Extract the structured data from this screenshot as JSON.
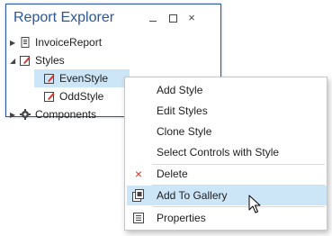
{
  "panel": {
    "title": "Report Explorer",
    "close_glyph": "×"
  },
  "tree": [
    {
      "label": "InvoiceReport",
      "icon": "report-icon",
      "expanded": false
    },
    {
      "label": "Styles",
      "icon": "styles-icon",
      "expanded": true
    },
    {
      "label": "EvenStyle",
      "icon": "style-icon",
      "selected": true
    },
    {
      "label": "OddStyle",
      "icon": "style-icon"
    },
    {
      "label": "Components",
      "icon": "gear-icon",
      "expanded": false
    }
  ],
  "context_menu": {
    "items": [
      {
        "label": "Add Style"
      },
      {
        "label": "Edit Styles"
      },
      {
        "label": "Clone Style"
      },
      {
        "label": "Select Controls with Style"
      },
      {
        "label": "Delete",
        "icon": "delete-icon"
      },
      {
        "label": "Add To Gallery",
        "icon": "gallery-icon",
        "hovered": true
      },
      {
        "label": "Properties",
        "icon": "properties-icon"
      }
    ],
    "delete_glyph": "×"
  },
  "colors": {
    "accent": "#2b579a",
    "selection": "#cde6f7",
    "delete_red": "#d9342b"
  }
}
